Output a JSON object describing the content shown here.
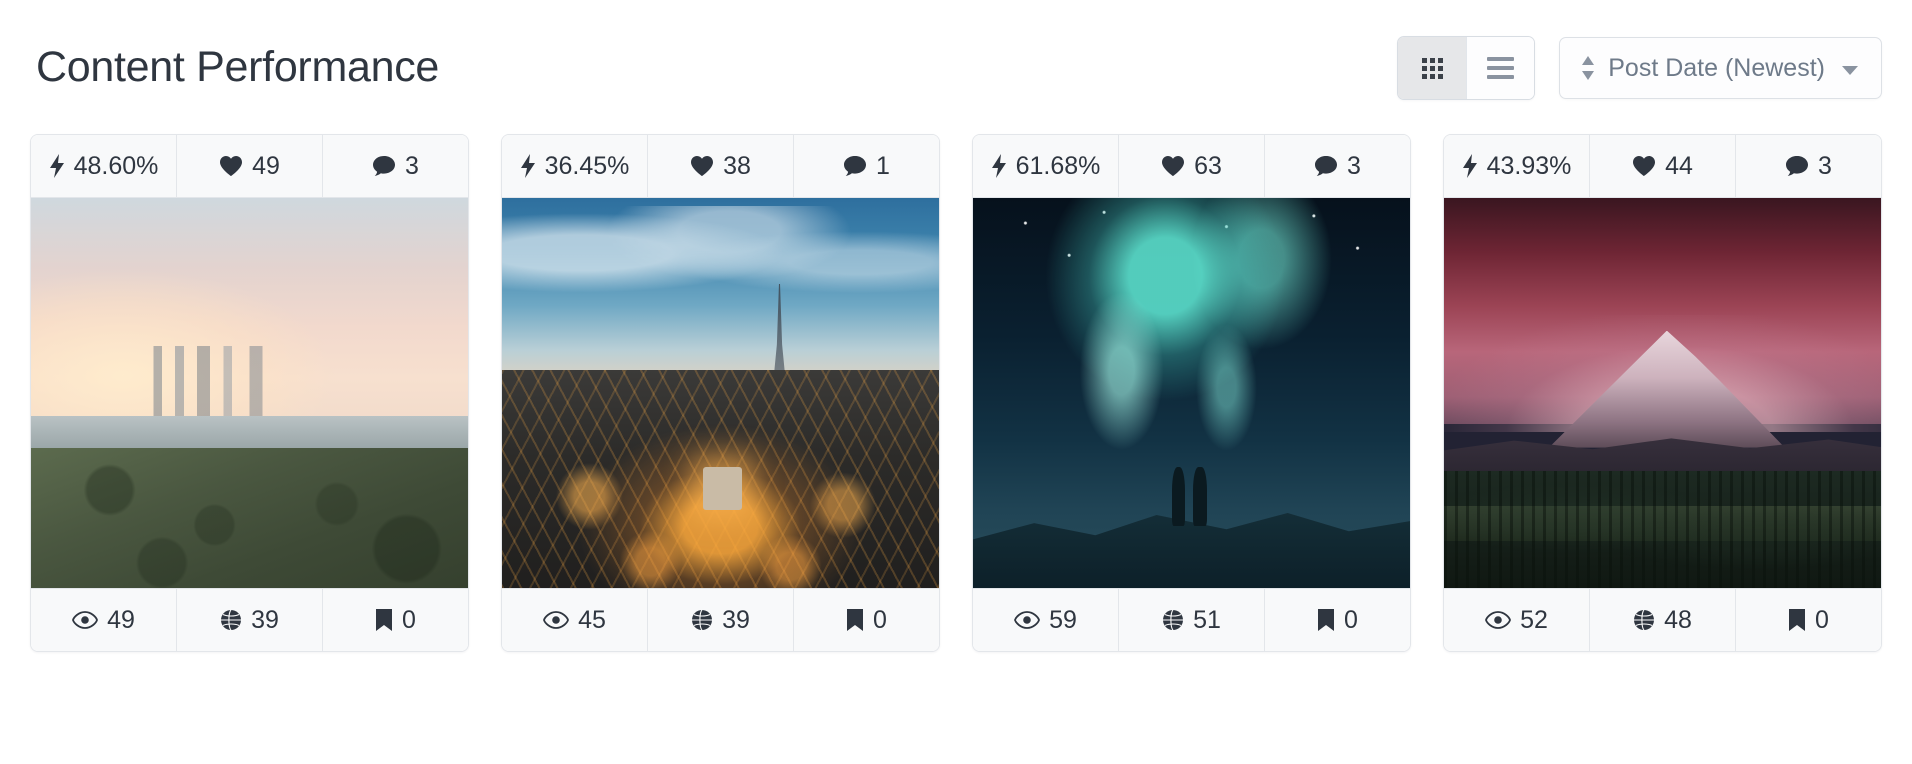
{
  "header": {
    "title": "Content Performance",
    "view_toggle": {
      "grid_label": "Grid view",
      "list_label": "List view",
      "active": "grid"
    },
    "sort": {
      "label": "Post Date (Newest)",
      "sort_icon": "sort-updown-icon",
      "caret_icon": "chevron-down-icon"
    }
  },
  "stat_icons": {
    "engagement": "lightning-bolt-icon",
    "likes": "heart-icon",
    "comments": "comment-bubble-icon",
    "views": "eye-icon",
    "reach": "globe-icon",
    "saves": "bookmark-icon"
  },
  "cards": [
    {
      "thumb": "coastal-city-sunset",
      "engagement": "48.60%",
      "likes": "49",
      "comments": "3",
      "views": "49",
      "reach": "39",
      "saves": "0"
    },
    {
      "thumb": "paris-aerial-dusk",
      "engagement": "36.45%",
      "likes": "38",
      "comments": "1",
      "views": "45",
      "reach": "39",
      "saves": "0"
    },
    {
      "thumb": "aurora-borealis",
      "engagement": "61.68%",
      "likes": "63",
      "comments": "3",
      "views": "59",
      "reach": "51",
      "saves": "0"
    },
    {
      "thumb": "mountain-dusk",
      "engagement": "43.93%",
      "likes": "44",
      "comments": "3",
      "views": "52",
      "reach": "48",
      "saves": "0"
    }
  ],
  "colors": {
    "title": "#2f3640",
    "muted": "#6e7a89",
    "border": "#e3e6ea",
    "stat_bg": "#f8f9fa",
    "active_toggle_bg": "#e6e7e9"
  }
}
